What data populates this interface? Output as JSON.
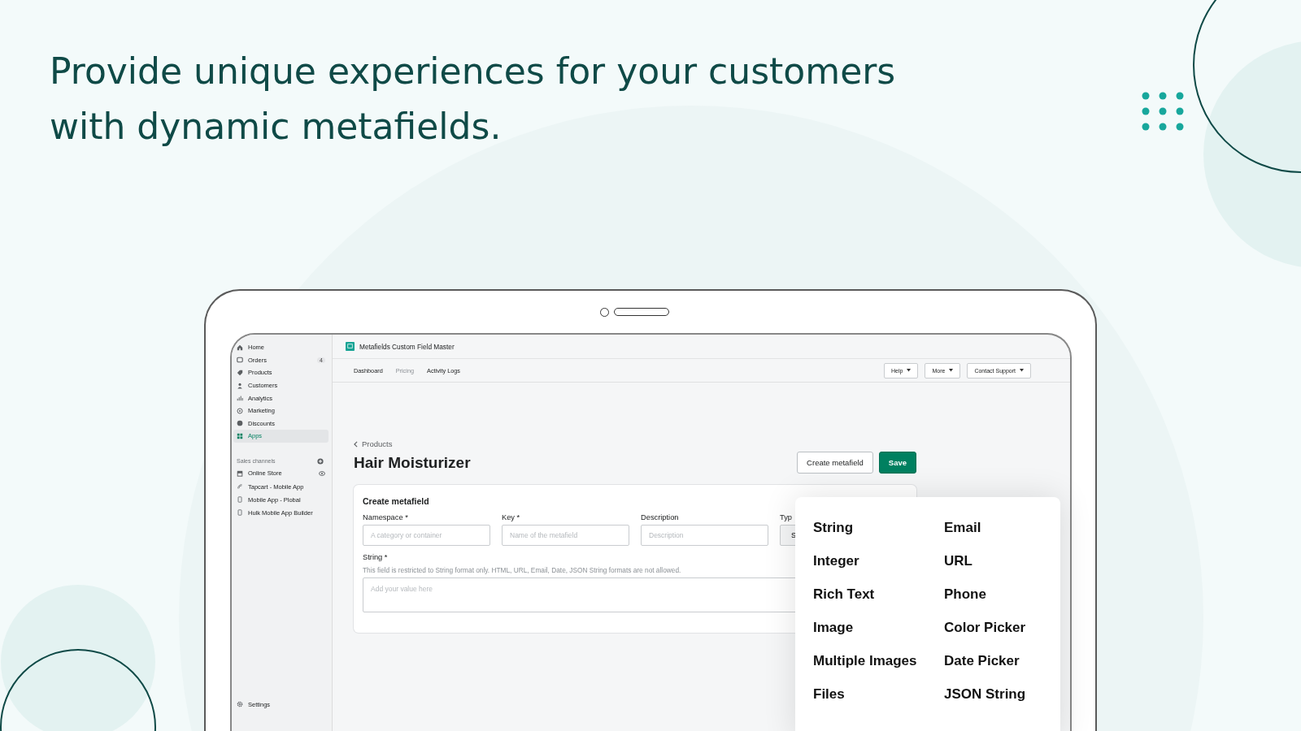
{
  "headline": [
    "Provide unique experiences for your customers",
    "with dynamic metafields."
  ],
  "sidebar": {
    "items": [
      {
        "label": "Home",
        "selected": false
      },
      {
        "label": "Orders",
        "selected": false,
        "badge": "4"
      },
      {
        "label": "Products",
        "selected": false
      },
      {
        "label": "Customers",
        "selected": false
      },
      {
        "label": "Analytics",
        "selected": false
      },
      {
        "label": "Marketing",
        "selected": false
      },
      {
        "label": "Discounts",
        "selected": false
      },
      {
        "label": "Apps",
        "selected": true
      }
    ],
    "sales_channels": {
      "title": "Sales channels",
      "items": [
        {
          "label": "Online Store"
        },
        {
          "label": "Tapcart - Mobile App"
        },
        {
          "label": "Mobile App - Plobal"
        },
        {
          "label": "Hulk Mobile App Builder"
        }
      ]
    },
    "settings": "Settings"
  },
  "app": {
    "title": "Metafields Custom Field Master",
    "tabs": [
      {
        "label": "Dashboard",
        "disabled": false
      },
      {
        "label": "Pricing",
        "disabled": true
      },
      {
        "label": "Activity Logs",
        "disabled": false
      }
    ],
    "menus": [
      "Help",
      "More",
      "Contact Support"
    ]
  },
  "page": {
    "breadcrumb": "Products",
    "title": "Hair Moisturizer",
    "buttons": [
      {
        "label": "Create metafield",
        "kind": "secondary"
      },
      {
        "label": "Save",
        "kind": "primary"
      }
    ],
    "card": {
      "title": "Create metafield",
      "fields": [
        {
          "label": "Namespace *",
          "placeholder": "A category or container"
        },
        {
          "label": "Key *",
          "placeholder": "Name of the metafield"
        },
        {
          "label": "Description",
          "placeholder": "Description"
        }
      ],
      "type_field": {
        "label": "Typ",
        "value": "S"
      },
      "value_field": {
        "label": "String *",
        "help": "This field is restricted to String format only. HTML, URL, Email, Date, JSON String formats are not allowed.",
        "placeholder": "Add your value here"
      }
    }
  },
  "type_options": [
    "String",
    "Email",
    "Integer",
    "URL",
    "Rich Text",
    "Phone",
    "Image",
    "Color Picker",
    "Multiple Images",
    "Date Picker",
    "Files",
    "JSON String"
  ]
}
